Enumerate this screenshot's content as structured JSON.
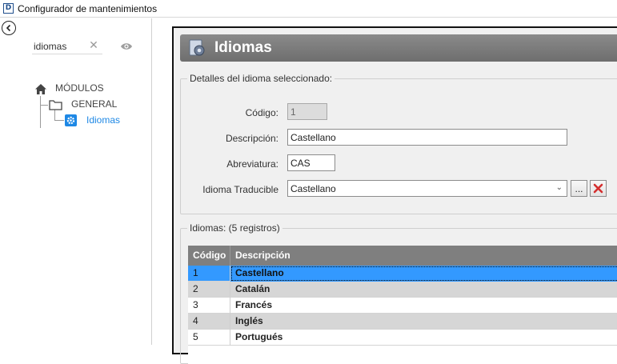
{
  "window": {
    "title": "Configurador de mantenimientos",
    "icon_letter": "D"
  },
  "sidebar": {
    "search": {
      "value": "idiomas",
      "placeholder": ""
    },
    "tree": {
      "root_label": "MÓDULOS",
      "group_label": "GENERAL",
      "item_label": "Idiomas"
    }
  },
  "header": {
    "title": "Idiomas"
  },
  "details": {
    "legend": "Detalles del idioma seleccionado:",
    "codigo_label": "Código:",
    "codigo_value": "1",
    "descripcion_label": "Descripción:",
    "descripcion_value": "Castellano",
    "abreviatura_label": "Abreviatura:",
    "abreviatura_value": "CAS",
    "traducible_label": "Idioma Traducible",
    "traducible_value": "Castellano",
    "browse_label": "..."
  },
  "list": {
    "legend": "Idiomas:  (5 registros)",
    "columns": [
      "Código",
      "Descripción"
    ],
    "rows": [
      {
        "codigo": "1",
        "descripcion": "Castellano"
      },
      {
        "codigo": "2",
        "descripcion": "Catalán"
      },
      {
        "codigo": "3",
        "descripcion": "Francés"
      },
      {
        "codigo": "4",
        "descripcion": "Inglés"
      },
      {
        "codigo": "5",
        "descripcion": "Portugués"
      }
    ],
    "selected_index": 0
  },
  "colors": {
    "accent": "#1e88e5",
    "selection": "#3399ff",
    "header_gray": "#7f7f7f",
    "delete_red": "#d32f2f"
  }
}
